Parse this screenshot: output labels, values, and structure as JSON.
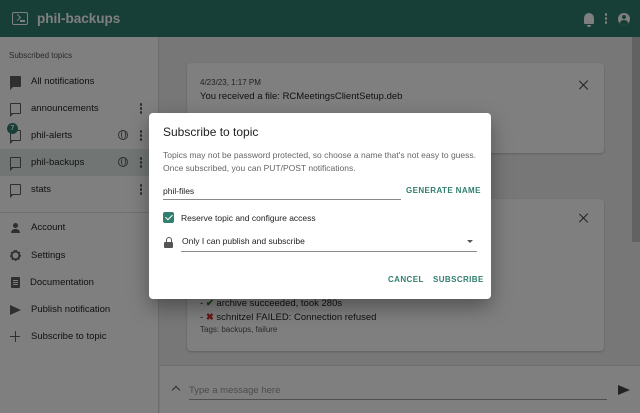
{
  "app": {
    "title": "phil-backups"
  },
  "colors": {
    "primary": "#317f6f",
    "sidebar_selected": "#e3ece9",
    "success": "#2e7d32",
    "error": "#d32f2f"
  },
  "header": {
    "icons": [
      "terminal-icon",
      "bell-icon",
      "more-vert-icon",
      "account-circle-icon"
    ]
  },
  "sidebar": {
    "header": "Subscribed topics",
    "items": [
      {
        "label": "All notifications",
        "icon": "chat-filled-icon"
      },
      {
        "label": "announcements",
        "icon": "chat-icon"
      },
      {
        "label": "phil-alerts",
        "icon": "chat-icon",
        "badge": "7"
      },
      {
        "label": "phil-backups",
        "icon": "chat-icon",
        "selected": true
      },
      {
        "label": "stats",
        "icon": "chat-icon"
      }
    ],
    "nav": [
      {
        "label": "Account",
        "icon": "person-icon"
      },
      {
        "label": "Settings",
        "icon": "gear-icon"
      },
      {
        "label": "Documentation",
        "icon": "doc-icon"
      },
      {
        "label": "Publish notification",
        "icon": "send-icon"
      },
      {
        "label": "Subscribe to topic",
        "icon": "plus-icon"
      }
    ]
  },
  "notifications": [
    {
      "date": "4/23/23, 1:17 PM",
      "message": "You received a file: RCMeetingsClientSetup.deb"
    },
    {
      "lines": [
        {
          "prefix": "- ",
          "mark": "✔",
          "text": " archive succeeded, took 280s"
        },
        {
          "prefix": "- ",
          "mark": "✖",
          "text": " schnitzel FAILED: Connection refused"
        }
      ],
      "tags": "Tags: backups, failure"
    }
  ],
  "message_bar": {
    "placeholder": "Type a message here"
  },
  "dialog": {
    "title": "Subscribe to topic",
    "description": "Topics may not be password protected, so choose a name that's not easy to guess. Once subscribed, you can PUT/POST notifications.",
    "topic_value": "phil-files",
    "generate_label": "GENERATE NAME",
    "reserve_label": "Reserve topic and configure access",
    "reserve_checked": true,
    "access_option": "Only I can publish and subscribe",
    "cancel_label": "CANCEL",
    "subscribe_label": "SUBSCRIBE"
  }
}
